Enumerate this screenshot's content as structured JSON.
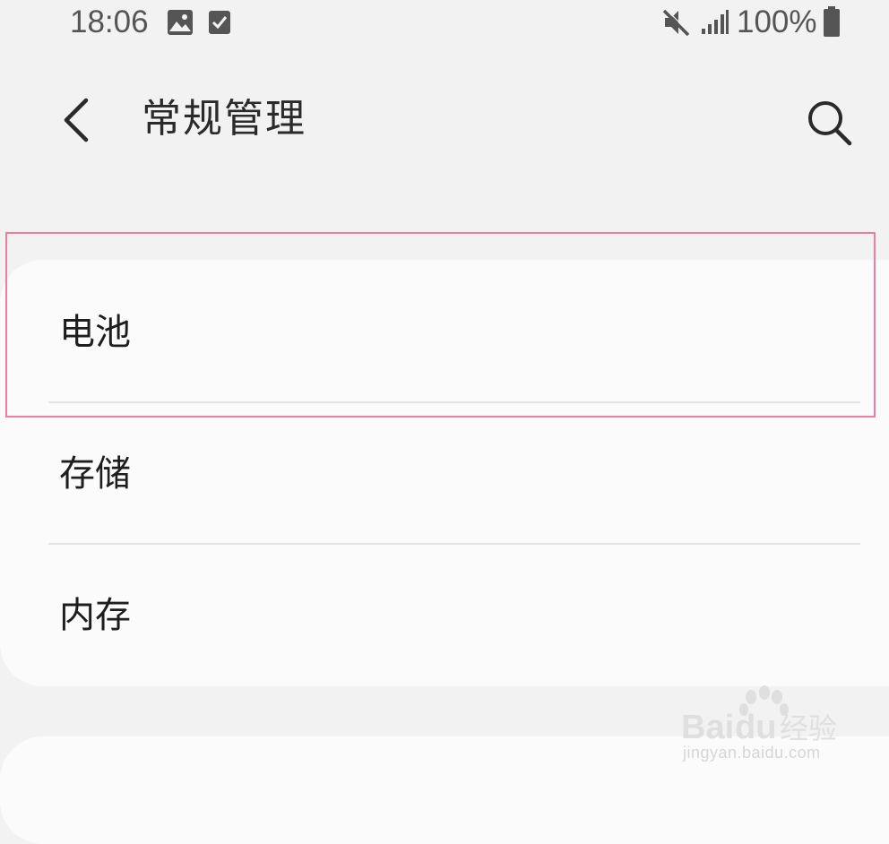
{
  "status_bar": {
    "time": "18:06",
    "battery": "100%",
    "icons": [
      "gallery-icon",
      "check-icon",
      "mute-icon",
      "signal-icon",
      "battery-icon"
    ]
  },
  "header": {
    "title": "常规管理",
    "back_icon": "chevron-left-icon",
    "search_icon": "search-icon"
  },
  "settings": {
    "items": [
      {
        "label": "电池"
      },
      {
        "label": "存储"
      },
      {
        "label": "内存"
      }
    ]
  },
  "highlight": {
    "color": "#ef7d9e"
  },
  "watermark": {
    "text": "Baidu经验",
    "url": "jingyan.baidu.com"
  }
}
